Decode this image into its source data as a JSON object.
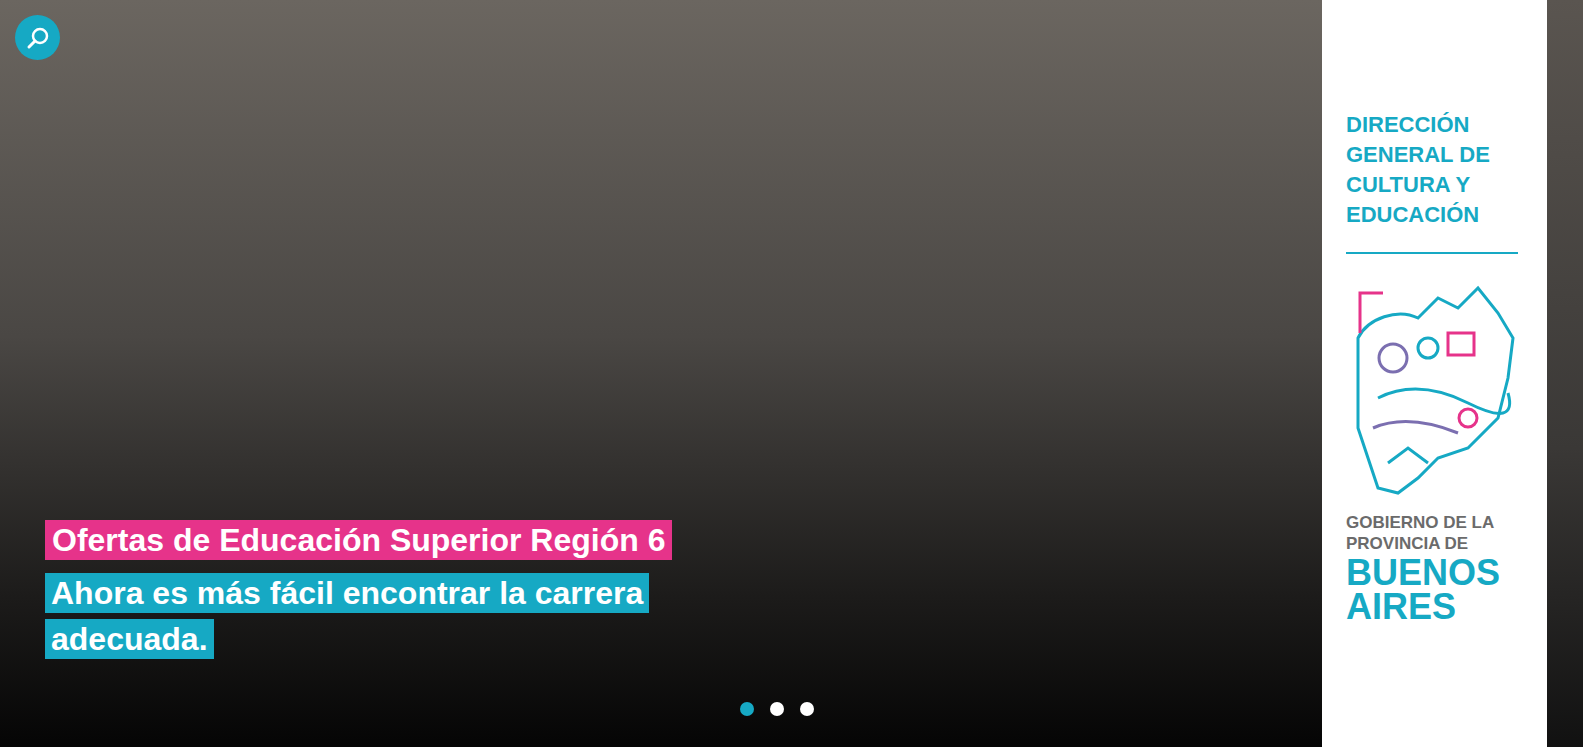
{
  "hero": {
    "title": "Ofertas de Educación Superior Región 6",
    "subtitle": "Ahora es más fácil encontrar la carrera adecuada."
  },
  "carousel": {
    "dots": [
      {
        "selected": true
      },
      {
        "selected": false
      },
      {
        "selected": false
      }
    ]
  },
  "brand": {
    "heading_lines": [
      "DIRECCIÓN",
      "GENERAL DE",
      "CULTURA Y",
      "EDUCACIÓN"
    ],
    "government_lines": [
      "GOBIERNO DE LA",
      "PROVINCIA DE"
    ],
    "province_lines": [
      "BUENOS",
      "AIRES"
    ]
  }
}
